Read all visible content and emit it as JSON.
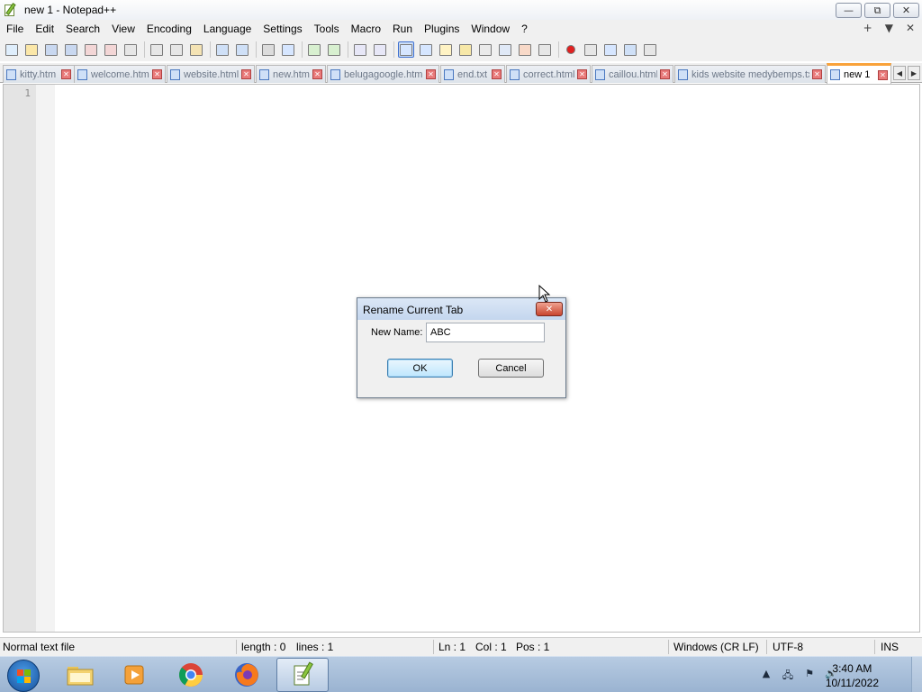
{
  "window": {
    "title": "new 1 - Notepad++",
    "buttons": {
      "minimize": "—",
      "restore": "⧉",
      "close": "✕"
    }
  },
  "menu": {
    "items": [
      "File",
      "Edit",
      "Search",
      "View",
      "Encoding",
      "Language",
      "Settings",
      "Tools",
      "Macro",
      "Run",
      "Plugins",
      "Window",
      "?"
    ],
    "right": {
      "plus": "+",
      "dropdown": "▼",
      "close": "✕"
    }
  },
  "toolbar": {
    "buttons": [
      "new-file",
      "open-file",
      "save",
      "save-all",
      "close",
      "close-all",
      "print",
      "cut",
      "copy",
      "paste",
      "undo",
      "redo",
      "find",
      "replace",
      "zoom-in",
      "zoom-out",
      "sync-vertical",
      "sync-horizontal",
      "word-wrap",
      "show-all-chars",
      "indent-guide",
      "user-language",
      "doc-map",
      "function-list",
      "folder-as-workspace",
      "monitoring",
      "record-macro",
      "stop-recording",
      "playback-macro",
      "run-macro-multiple",
      "save-macro"
    ]
  },
  "tabs": [
    {
      "label": "kitty.htm",
      "active": false
    },
    {
      "label": "welcome.html",
      "active": false
    },
    {
      "label": "website.html",
      "active": false
    },
    {
      "label": "new.htm",
      "active": false
    },
    {
      "label": "belugagoogle.html",
      "active": false
    },
    {
      "label": "end.txt",
      "active": false
    },
    {
      "label": "correct.html",
      "active": false
    },
    {
      "label": "caillou.html",
      "active": false
    },
    {
      "label": "kids website medybemps.txt",
      "active": false
    },
    {
      "label": "new 1",
      "active": true
    }
  ],
  "tab_arrows": {
    "left": "◀",
    "right": "▶"
  },
  "editor": {
    "line_numbers": [
      "1"
    ],
    "content": ""
  },
  "dialog": {
    "title": "Rename Current Tab",
    "close": "✕",
    "label": "New Name:",
    "value": "ABC",
    "ok": "OK",
    "cancel": "Cancel"
  },
  "status": {
    "file_type": "Normal text file",
    "length": "length : 0",
    "lines": "lines : 1",
    "ln": "Ln : 1",
    "col": "Col : 1",
    "pos": "Pos : 1",
    "eol": "Windows (CR LF)",
    "encoding": "UTF-8",
    "mode": "INS"
  },
  "taskbar": {
    "apps": [
      "file-explorer",
      "media-player",
      "chrome",
      "firefox",
      "notepad-plus-plus"
    ],
    "active_app": "notepad-plus-plus",
    "tray": {
      "arrow": "▲",
      "network": "🖧",
      "flag": "⚑",
      "volume": "🔊"
    },
    "time": "3:40 AM",
    "date": "10/11/2022"
  },
  "colors": {
    "active_tab_accent": "#f9a23a",
    "dialog_ok": "#bee6fd",
    "taskbar": "#9ab3d1"
  }
}
